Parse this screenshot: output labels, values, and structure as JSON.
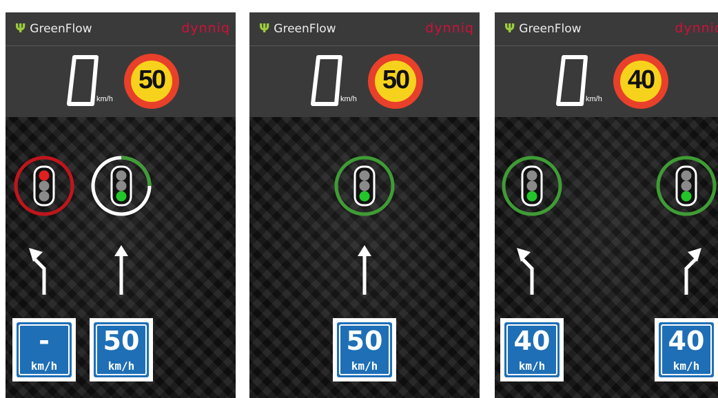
{
  "app": {
    "name": "GreenFlow",
    "vendor_logo": "dynniq",
    "icon": "leaf-icon"
  },
  "colors": {
    "red": "#c0151c",
    "green": "#3f9c35",
    "white": "#ffffff",
    "sign_red": "#e8402a",
    "sign_yellow": "#f7d21c",
    "plate_blue": "#1e6fb6"
  },
  "screens": [
    {
      "current_speed": "0",
      "speed_unit": "km/h",
      "speed_limit": "50",
      "lanes": [
        {
          "direction": "left",
          "light": "red",
          "ring": "red",
          "advised_speed": "-",
          "advised_unit": "km/h"
        },
        {
          "direction": "straight",
          "light": "green",
          "ring": "white-green",
          "advised_speed": "50",
          "advised_unit": "km/h"
        }
      ]
    },
    {
      "current_speed": "0",
      "speed_unit": "km/h",
      "speed_limit": "50",
      "lanes": [
        {
          "direction": "straight",
          "light": "green",
          "ring": "green",
          "advised_speed": "50",
          "advised_unit": "km/h"
        }
      ]
    },
    {
      "current_speed": "0",
      "speed_unit": "km/h",
      "speed_limit": "40",
      "lanes": [
        {
          "direction": "left",
          "light": "green",
          "ring": "green",
          "advised_speed": "40",
          "advised_unit": "km/h"
        },
        {
          "direction": "right",
          "light": "green",
          "ring": "green",
          "advised_speed": "40",
          "advised_unit": "km/h"
        }
      ]
    }
  ]
}
